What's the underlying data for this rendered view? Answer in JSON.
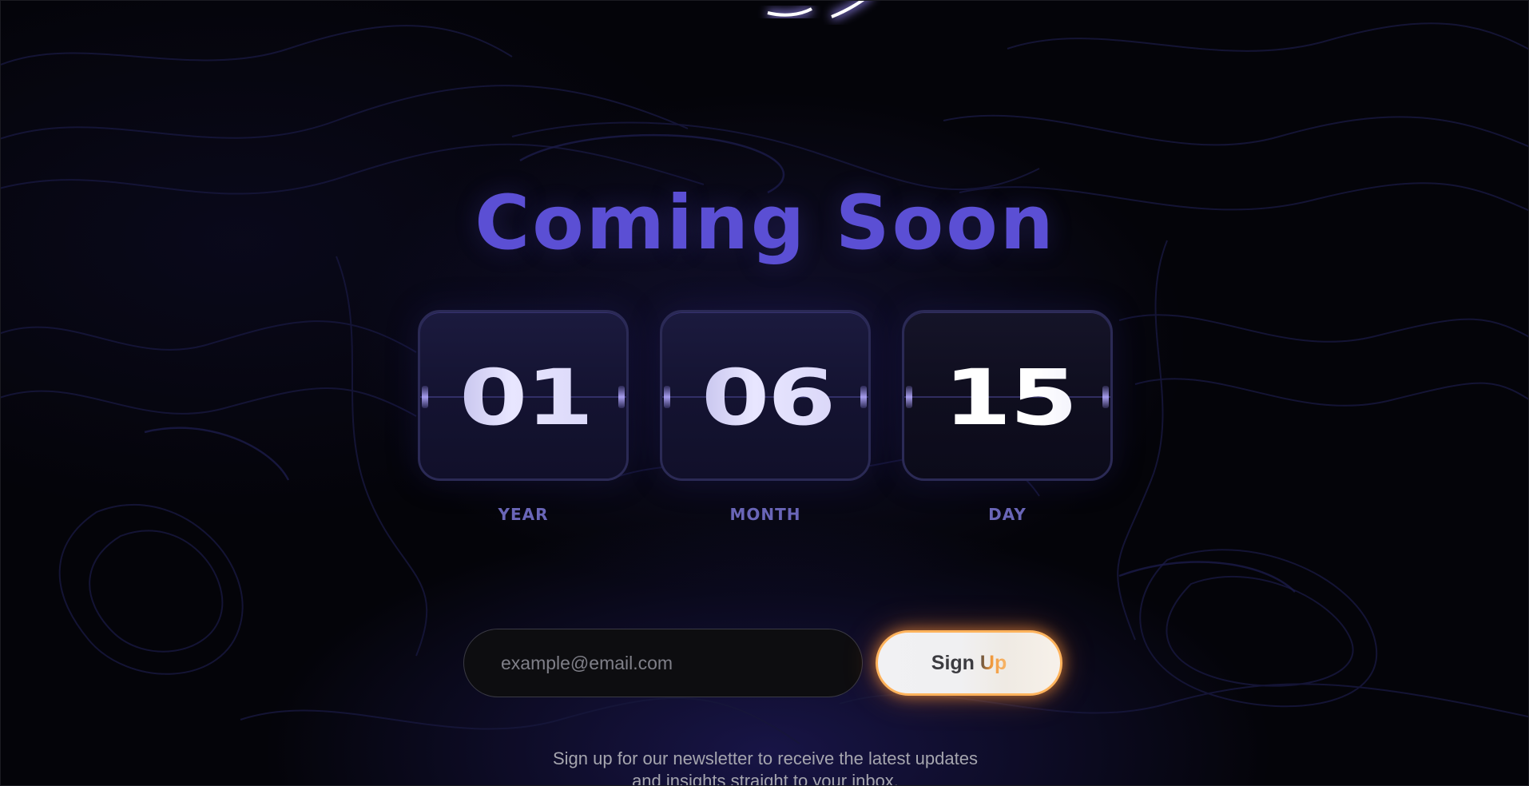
{
  "hero": {
    "title": "Coming Soon"
  },
  "countdown": [
    {
      "value": "01",
      "label": "YEAR"
    },
    {
      "value": "06",
      "label": "MONTH"
    },
    {
      "value": "15",
      "label": "DAY"
    }
  ],
  "signup": {
    "email_placeholder": "example@email.com",
    "button_label": "Sign Up"
  },
  "newsletter": {
    "line1": "Sign up for our newsletter to receive the latest updates",
    "line2": "and insights straight to your inbox."
  },
  "colors": {
    "title": "#5b4fd4",
    "accent_glow": "#ffb35c",
    "label": "#6a66b8"
  },
  "icons": {
    "logo": "logo-glow-icon"
  }
}
